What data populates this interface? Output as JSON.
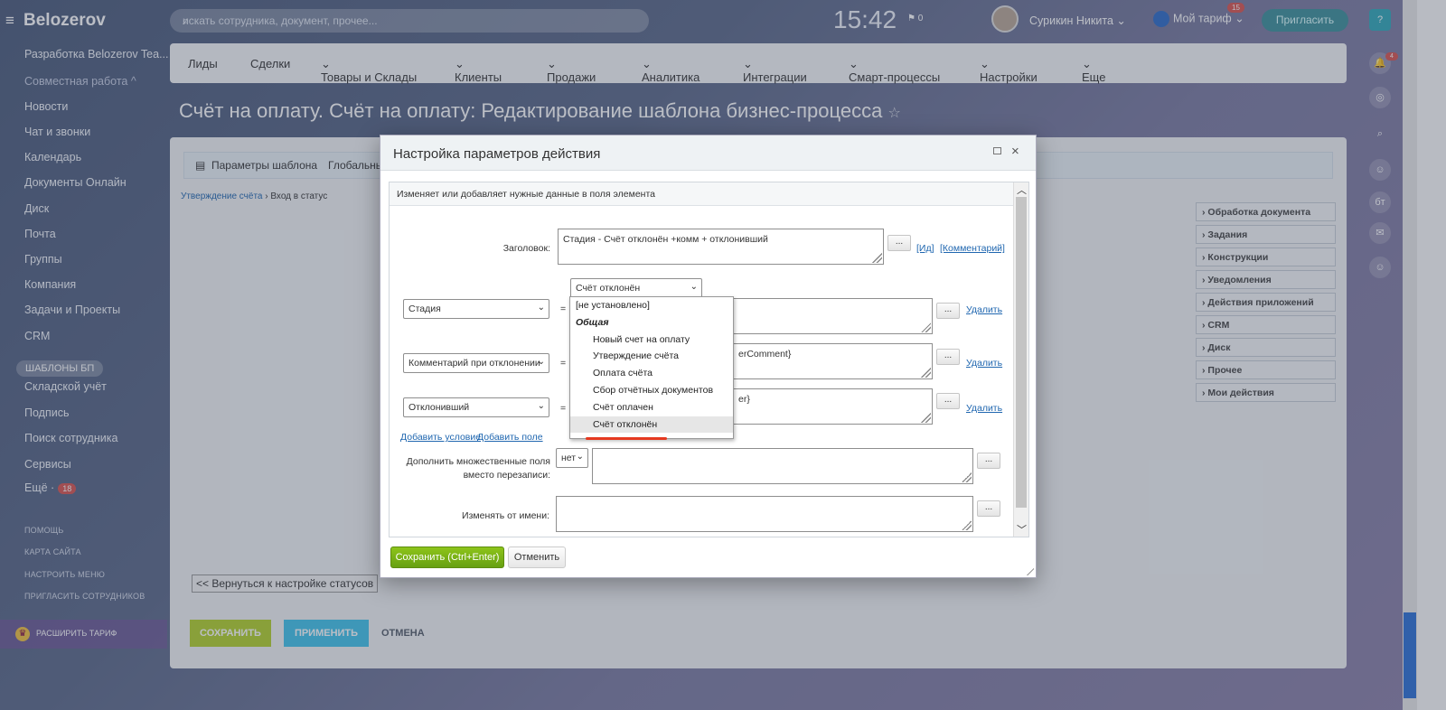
{
  "app": {
    "logo": "Belozerov",
    "menu_icon": "hamburger-icon"
  },
  "sidebar": {
    "items": [
      {
        "label": "Разработка Belozerov Tea..."
      },
      {
        "label": "Совместная работа ^"
      },
      {
        "label": "Новости"
      },
      {
        "label": "Чат и звонки"
      },
      {
        "label": "Календарь"
      },
      {
        "label": "Документы Онлайн"
      },
      {
        "label": "Диск"
      },
      {
        "label": "Почта"
      },
      {
        "label": "Группы"
      },
      {
        "label": "Компания"
      },
      {
        "label": "Задачи и Проекты"
      },
      {
        "label": "CRM"
      },
      {
        "label": "ШАБЛОНЫ БП"
      },
      {
        "label": "Складской учёт"
      },
      {
        "label": "Подпись"
      },
      {
        "label": "Поиск сотрудника"
      },
      {
        "label": "Сервисы"
      },
      {
        "label": "Ещё ·",
        "badge": "18"
      }
    ],
    "footer": [
      "ПОМОЩЬ",
      "КАРТА САЙТА",
      "НАСТРОИТЬ МЕНЮ",
      "ПРИГЛАСИТЬ СОТРУДНИКОВ"
    ],
    "tarif": "РАСШИРИТЬ ТАРИФ"
  },
  "header": {
    "search_placeholder": "искать сотрудника, документ, прочее...",
    "clock": "15:42",
    "flag_count": "0",
    "user_name": "Сурикин Никита",
    "plan_label": "Мой тариф",
    "plan_badge": "15",
    "invite_label": "Пригласить",
    "notif_badge": "4"
  },
  "topnav": [
    "Лиды",
    "Сделки",
    "Товары и Склады",
    "Клиенты",
    "Продажи",
    "Аналитика",
    "Интеграции",
    "Смарт-процессы",
    "Настройки",
    "Еще"
  ],
  "page_title": "Счёт на оплату. Счёт на оплату: Редактирование шаблона бизнес-процесса",
  "workarea": {
    "tabs": [
      "Параметры шаблона",
      "Глобальны"
    ],
    "breadcrumb_link": "Утверждение счёта",
    "breadcrumb_current": " › Вход в статус",
    "actions": [
      "Обработка документа",
      "Задания",
      "Конструкции",
      "Уведомления",
      "Действия приложений",
      "CRM",
      "Диск",
      "Прочее",
      "Мои действия"
    ],
    "back_button": "<< Вернуться к настройке статусов",
    "save": "СОХРАНИТЬ",
    "apply": "ПРИМЕНИТЬ",
    "cancel": "ОТМЕНА"
  },
  "dialog": {
    "title": "Настройка параметров действия",
    "description": "Изменяет или добавляет нужные данные в поля элемента",
    "title_label": "Заголовок:",
    "title_value": "Стадия - Счёт отклонён +комм + отклонивший",
    "link_id": "[Ид]",
    "link_comment": "[Комментарий]",
    "stage_select_value": "Счёт отклонён",
    "rows": [
      {
        "field": "Стадия",
        "text": "",
        "delete": "Удалить"
      },
      {
        "field": "Комментарий при отклонении",
        "text": "erComment}",
        "delete": "Удалить"
      },
      {
        "field": "Отклонивший",
        "text": "er}",
        "delete": "Удалить"
      }
    ],
    "add_condition": "Добавить условие",
    "add_field": "Добавить поле",
    "multi_label_1": "Дополнить множественные поля",
    "multi_label_2": "вместо перезаписи:",
    "multi_value": "нет",
    "change_from_label": "Изменять от имени:",
    "dots": "...",
    "dropdown": {
      "unset": "[не установлено]",
      "group": "Общая",
      "options": [
        "Новый счет на оплату",
        "Утверждение счёта",
        "Оплата счёта",
        "Сбор отчётных документов",
        "Счёт оплачен",
        "Счёт отклонён"
      ]
    },
    "save_button": "Сохранить (Ctrl+Enter)",
    "cancel_button": "Отменить"
  }
}
